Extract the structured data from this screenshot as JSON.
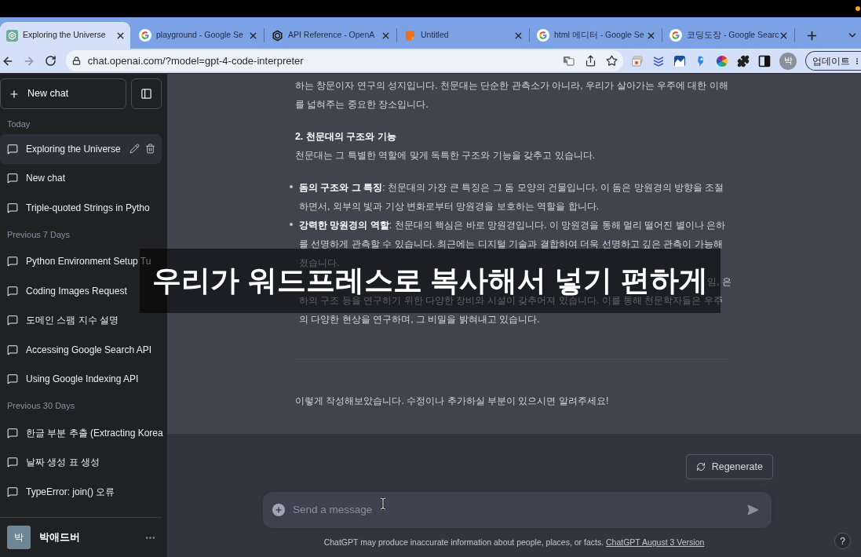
{
  "browser": {
    "tabs": [
      {
        "title": "Exploring the Universe",
        "kind": "app",
        "selected": true
      },
      {
        "title": "playground - Google Se",
        "kind": "search",
        "selected": false
      },
      {
        "title": "API Reference - OpenA",
        "kind": "docs",
        "selected": false
      },
      {
        "title": "Untitled",
        "kind": "document",
        "selected": false
      },
      {
        "title": "html 에디터 - Google Se",
        "kind": "search",
        "selected": false
      },
      {
        "title": "코딩도장 - Google Searc",
        "kind": "search",
        "selected": false
      }
    ],
    "address": "chat.openai.com/?model=gpt-4-code-interpreter",
    "profile_initial": "박",
    "update_button": "업데이트"
  },
  "sidebar": {
    "new_chat": "New chat",
    "sections": [
      {
        "label": "Today",
        "items": [
          {
            "title": "Exploring the Universe",
            "selected": true
          },
          {
            "title": "New chat",
            "selected": false
          },
          {
            "title": "Triple-quoted Strings in Pytho",
            "selected": false
          }
        ]
      },
      {
        "label": "Previous 7 Days",
        "items": [
          {
            "title": "Python Environment Setup Tu",
            "selected": false
          },
          {
            "title": "Coding Images Request",
            "selected": false
          },
          {
            "title": "도메인 스팸 지수 설명",
            "selected": false
          },
          {
            "title": "Accessing Google Search API",
            "selected": false
          },
          {
            "title": "Using Google Indexing API",
            "selected": false
          }
        ]
      },
      {
        "label": "Previous 30 Days",
        "items": [
          {
            "title": "한글 부분 추출 (Extracting Korea",
            "selected": false
          },
          {
            "title": "날짜 생성 표 생성",
            "selected": false
          },
          {
            "title": "TypeError: join() 오류",
            "selected": false
          }
        ]
      }
    ],
    "user": {
      "avatar": "박",
      "name": "박애드버"
    }
  },
  "message": {
    "blocks": [
      {
        "kind": "paragraph",
        "text": "하는 창문이자 연구의 성지입니다. 천문대는 단순한 관측소가 아니라, 우리가 살아가는 우주에 대한 이해를 넓혀주는 중요한 장소입니다."
      },
      {
        "kind": "heading",
        "text": "2. 천문대의 구조와 기능"
      },
      {
        "kind": "paragraph",
        "text": "천문대는 그 특별한 역할에 맞게 독특한 구조와 기능을 갖추고 있습니다."
      },
      {
        "kind": "list",
        "items": [
          {
            "kind": "bullet",
            "text": "**돔의 구조와 그 특징**: 천문대의 가장 큰 특징은 그 돔 모양의 건물입니다. 이 돔은 망원경의 방향을 조절하면서, 외부의 빛과 기상 변화로부터 망원경을 보호하는 역할을 합니다."
          },
          {
            "kind": "bullet",
            "text": "**강력한 망원경의 역할**: 천문대의 핵심은 바로 망원경입니다. 이 망원경을 통해 멀리 떨어진 별이나 은하를 선명하게 관측할 수 있습니다. 최근에는 디지털 기술과 결합하여 더욱 선명하고 깊은 관측이 가능해졌습니다."
          },
          {
            "kind": "covered",
            "fragment": "임, 은",
            "text": "하의 구조 등을 연구하기 위한 다양한 장비와 시설이 갖추어져 있습니다. 이를 통해 천문학자들은 우주의 다양한 현상을 연구하며, 그 비밀을 밝혀내고 있습니다."
          }
        ]
      }
    ],
    "closing": "이렇게 작성해보았습니다. 수정이나 추가하실 부분이 있으시면 알려주세요!"
  },
  "composer": {
    "regenerate": "Regenerate",
    "placeholder": "Send a message",
    "disclaimer": "ChatGPT may produce inaccurate information about people, places, or facts.",
    "version_link": "ChatGPT August 3 Version"
  },
  "help": "?",
  "caption": "우리가 워드프레스로 복사해서 넣기 편하게"
}
